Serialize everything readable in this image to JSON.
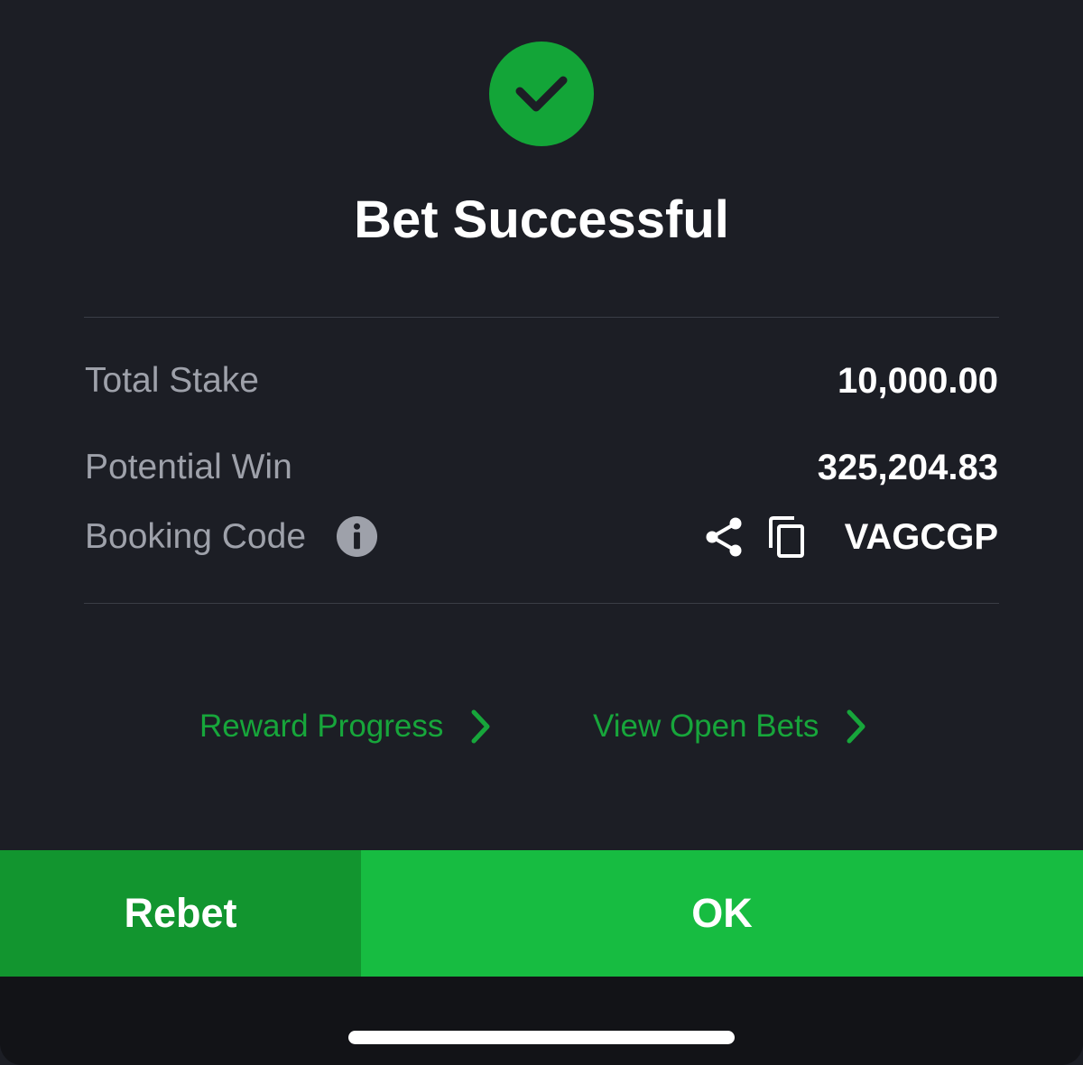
{
  "header": {
    "title": "Bet Successful",
    "status_icon": "checkmark-icon",
    "status_color": "#13a538"
  },
  "details": {
    "total_stake": {
      "label": "Total Stake",
      "value": "10,000.00"
    },
    "potential_win": {
      "label": "Potential Win",
      "value": "325,204.83"
    },
    "booking_code": {
      "label": "Booking Code",
      "value": "VAGCGP",
      "info_icon": "info-icon",
      "share_icon": "share-icon",
      "copy_icon": "copy-icon"
    }
  },
  "links": {
    "reward_progress": "Reward Progress",
    "view_open_bets": "View Open Bets",
    "link_color": "#17a63b"
  },
  "actions": {
    "rebet_label": "Rebet",
    "ok_label": "OK",
    "rebet_color": "#12952f",
    "ok_color": "#17bc41"
  }
}
